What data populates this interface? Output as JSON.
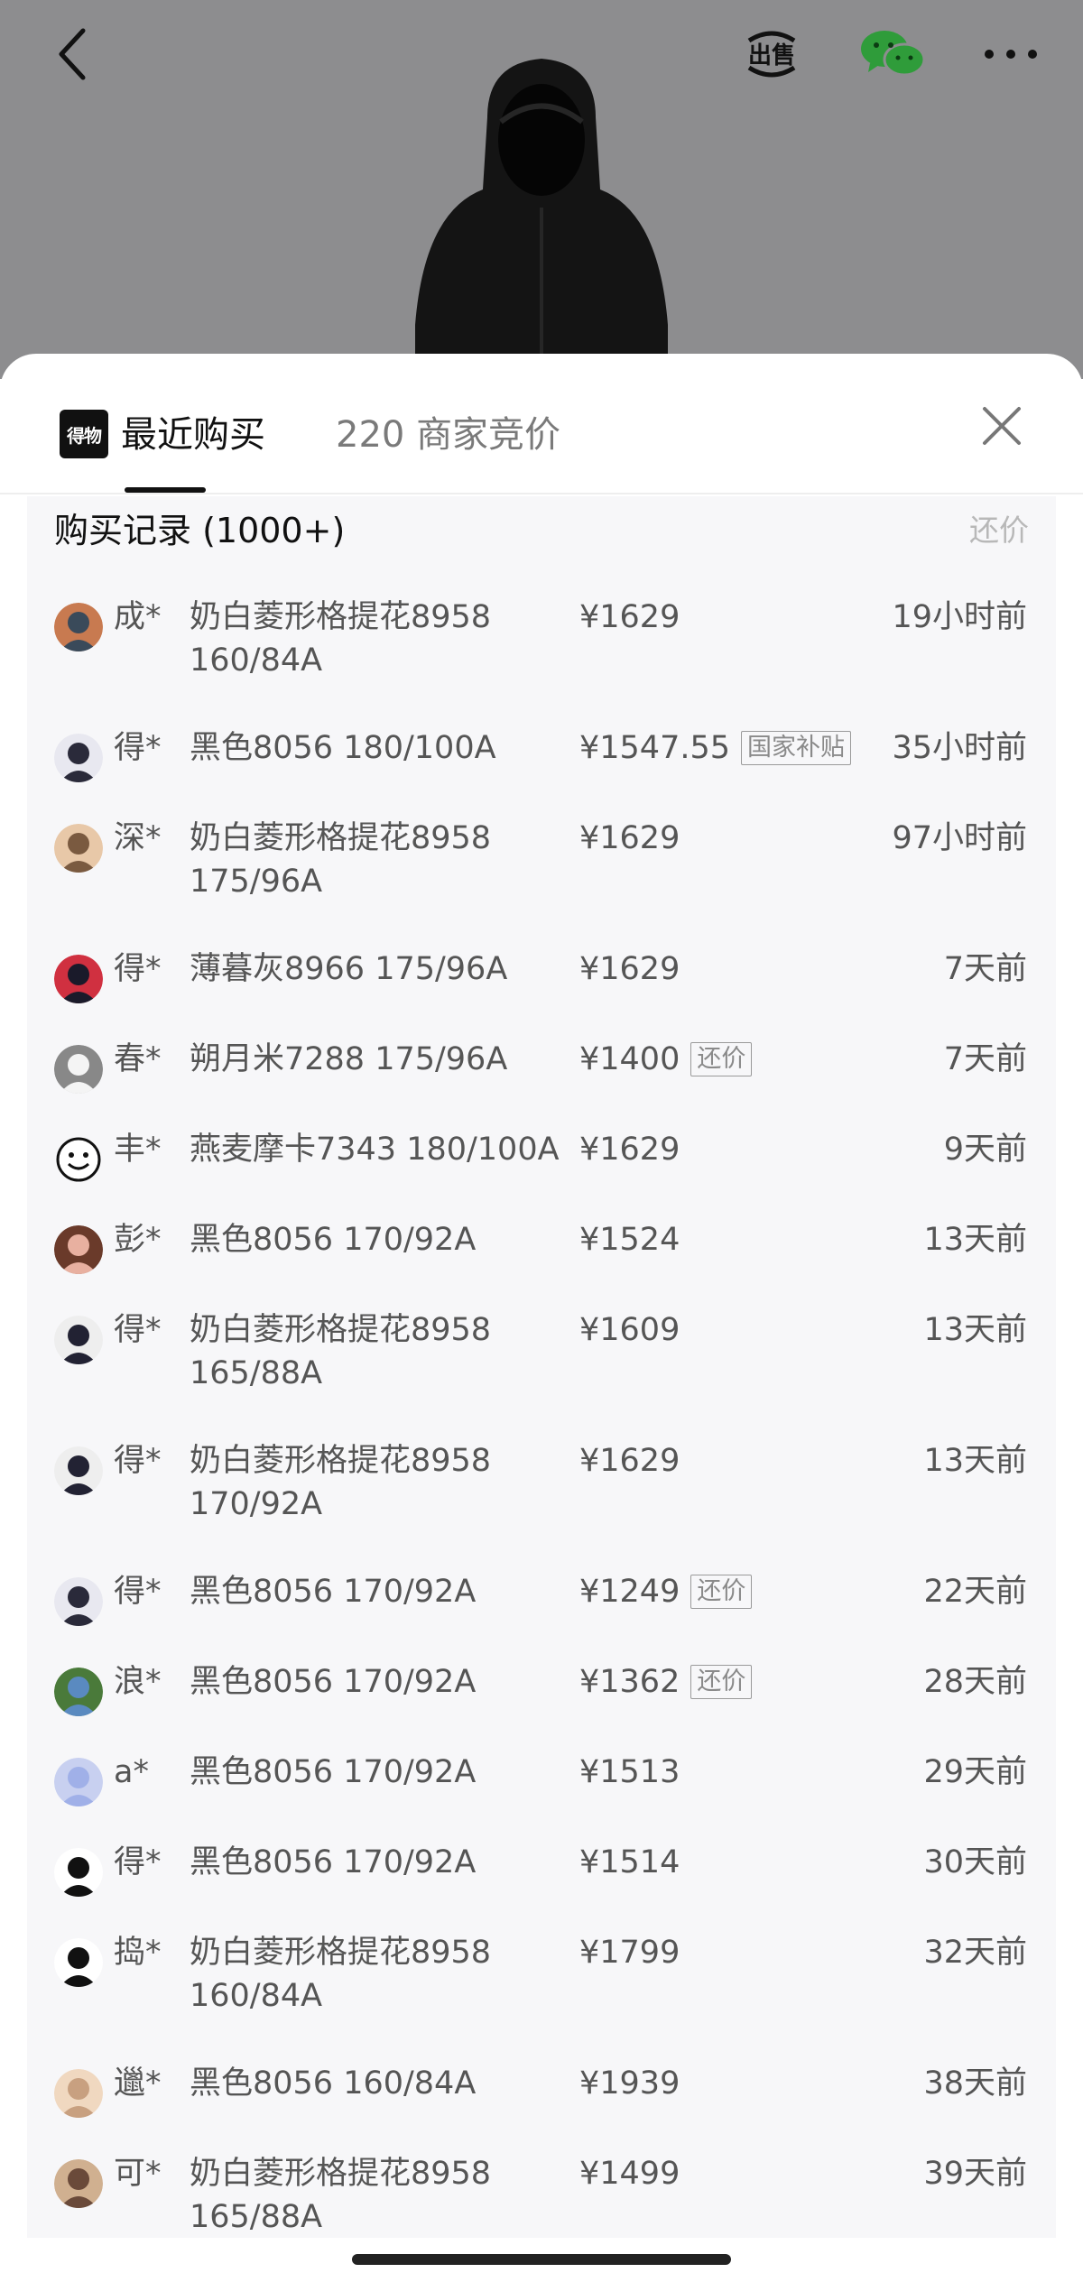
{
  "sheet": {
    "brand_logo_text": "得物",
    "tabs": [
      {
        "label": "最近购买",
        "active": true
      },
      {
        "label": "220 商家竞价",
        "active": false
      }
    ]
  },
  "records": {
    "title": "购买记录 (1000+)",
    "action_label": "还价",
    "rows": [
      {
        "user": "成*",
        "product": "奶白菱形格提花8958 160/84A",
        "price": "¥1629",
        "tag": "",
        "time": "19小时前"
      },
      {
        "user": "得*",
        "product": "黑色8056 180/100A",
        "price": "¥1547.55",
        "tag": "国家补贴",
        "time": "35小时前"
      },
      {
        "user": "深*",
        "product": "奶白菱形格提花8958 175/96A",
        "price": "¥1629",
        "tag": "",
        "time": "97小时前"
      },
      {
        "user": "得*",
        "product": "薄暮灰8966 175/96A",
        "price": "¥1629",
        "tag": "",
        "time": "7天前"
      },
      {
        "user": "春*",
        "product": "朔月米7288 175/96A",
        "price": "¥1400",
        "tag": "还价",
        "time": "7天前"
      },
      {
        "user": "丰*",
        "product": "燕麦摩卡7343 180/100A",
        "price": "¥1629",
        "tag": "",
        "time": "9天前"
      },
      {
        "user": "彭*",
        "product": "黑色8056 170/92A",
        "price": "¥1524",
        "tag": "",
        "time": "13天前"
      },
      {
        "user": "得*",
        "product": "奶白菱形格提花8958 165/88A",
        "price": "¥1609",
        "tag": "",
        "time": "13天前"
      },
      {
        "user": "得*",
        "product": "奶白菱形格提花8958 170/92A",
        "price": "¥1629",
        "tag": "",
        "time": "13天前"
      },
      {
        "user": "得*",
        "product": "黑色8056 170/92A",
        "price": "¥1249",
        "tag": "还价",
        "time": "22天前"
      },
      {
        "user": "浪*",
        "product": "黑色8056 170/92A",
        "price": "¥1362",
        "tag": "还价",
        "time": "28天前"
      },
      {
        "user": "a*",
        "product": "黑色8056 170/92A",
        "price": "¥1513",
        "tag": "",
        "time": "29天前"
      },
      {
        "user": "得*",
        "product": "黑色8056 170/92A",
        "price": "¥1514",
        "tag": "",
        "time": "30天前"
      },
      {
        "user": "捣*",
        "product": "奶白菱形格提花8958 160/84A",
        "price": "¥1799",
        "tag": "",
        "time": "32天前"
      },
      {
        "user": "邋*",
        "product": "黑色8056 160/84A",
        "price": "¥1939",
        "tag": "",
        "time": "38天前"
      },
      {
        "user": "可*",
        "product": "奶白菱形格提花8958 165/88A",
        "price": "¥1499",
        "tag": "",
        "time": "39天前"
      }
    ]
  }
}
